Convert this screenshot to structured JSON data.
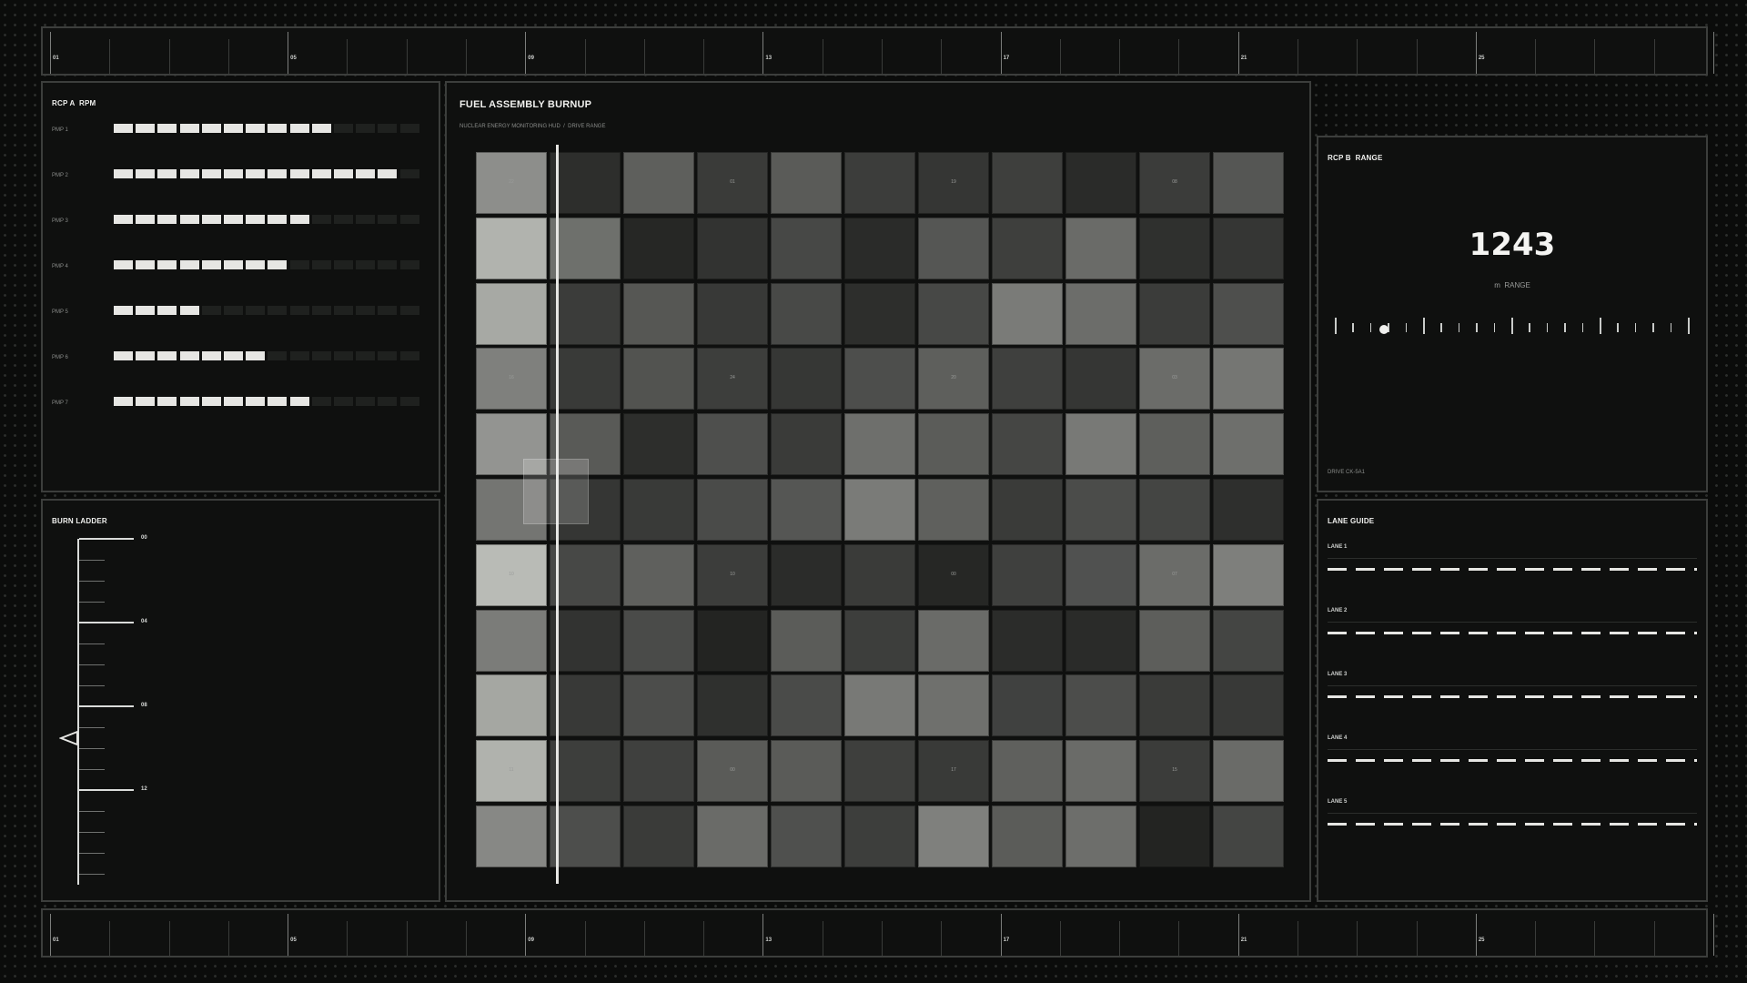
{
  "top_ruler": {
    "labels": [
      "01",
      "05",
      "09",
      "13",
      "17",
      "21",
      "25"
    ]
  },
  "bottom_ruler": {
    "labels": [
      "01",
      "05",
      "09",
      "13",
      "17",
      "21",
      "25"
    ]
  },
  "rpm_panel": {
    "title": "RCP A  RPM",
    "total_segments": 14,
    "pumps": [
      {
        "label": "PMP 1",
        "active": 10
      },
      {
        "label": "PMP 2",
        "active": 13
      },
      {
        "label": "PMP 3",
        "active": 9
      },
      {
        "label": "PMP 4",
        "active": 8
      },
      {
        "label": "PMP 5",
        "active": 4
      },
      {
        "label": "PMP 6",
        "active": 7
      },
      {
        "label": "PMP 7",
        "active": 9
      }
    ]
  },
  "burn_ladder": {
    "title": "BURN LADDER",
    "labels": [
      "00",
      "04",
      "08",
      "12"
    ],
    "marker_value": 9.5
  },
  "burnup": {
    "title": "FUEL ASSEMBLY BURNUP",
    "subtitle": "NUCLEAR ENERGY MONITORING HUD  /  DRIVE RANGE",
    "scan_column": 1.1,
    "grid": [
      [
        "#8d8e8b",
        "#2d2e2c",
        "#5e5f5c",
        "#3a3b39",
        "#5a5b58",
        "#3c3d3b",
        "#353634",
        "#3e3f3d",
        "#2a2b29",
        "#3b3c3a",
        "#555654"
      ],
      [
        "#b1b3ae",
        "#6e706c",
        "#262725",
        "#323331",
        "#474846",
        "#2a2b29",
        "#555654",
        "#3e3f3d",
        "#6a6b68",
        "#2f302e",
        "#353634"
      ],
      [
        "#a7a9a4",
        "#3b3c3a",
        "#565754",
        "#383937",
        "#484947",
        "#2d2e2c",
        "#474846",
        "#7a7b78",
        "#6c6d6a",
        "#3b3c3a",
        "#4e4f4d"
      ],
      [
        "#7f807d",
        "#393a38",
        "#525350",
        "#3d3e3c",
        "#363735",
        "#4d4e4c",
        "#5e5f5c",
        "#3f403e",
        "#353634",
        "#6b6c69",
        "#757673"
      ],
      [
        "#939491",
        "#595a57",
        "#2d2e2c",
        "#4e4f4d",
        "#3a3b39",
        "#6e6f6c",
        "#5b5c59",
        "#454644",
        "#787976",
        "#5e5f5c",
        "#6e6f6c"
      ],
      [
        "#747572",
        "#353634",
        "#393a38",
        "#4a4b49",
        "#555654",
        "#7a7b78",
        "#5f605d",
        "#3a3b39",
        "#4b4c4a",
        "#444543",
        "#2e2f2d"
      ],
      [
        "#b9bbb6",
        "#474846",
        "#5f605d",
        "#3c3d3b",
        "#2b2c2a",
        "#3a3b39",
        "#262725",
        "#3f403e",
        "#505150",
        "#6b6c69",
        "#7e7f7c"
      ],
      [
        "#7b7c79",
        "#323331",
        "#4a4b49",
        "#232422",
        "#5b5c59",
        "#3d3e3c",
        "#6a6b68",
        "#2b2c2a",
        "#2a2b29",
        "#5d5e5b",
        "#444543"
      ],
      [
        "#a5a7a2",
        "#383937",
        "#4c4d4b",
        "#2f302e",
        "#4a4b49",
        "#787976",
        "#6f706d",
        "#404140",
        "#4c4d4b",
        "#3a3b39",
        "#383937"
      ],
      [
        "#b0b2ad",
        "#3d3e3c",
        "#3f403e",
        "#5a5b58",
        "#5a5b58",
        "#3e3f3d",
        "#393a38",
        "#5f605d",
        "#6a6b68",
        "#3b3c3a",
        "#6a6b68"
      ],
      [
        "#878885",
        "#4d4e4c",
        "#3a3b39",
        "#6a6b68",
        "#4f504e",
        "#3d3e3c",
        "#7f807d",
        "#5b5c59",
        "#6d6e6b",
        "#232422",
        "#444543"
      ]
    ],
    "labels": [
      {
        "row": 0,
        "col": 0,
        "text": "22"
      },
      {
        "row": 0,
        "col": 3,
        "text": "01"
      },
      {
        "row": 0,
        "col": 6,
        "text": "19"
      },
      {
        "row": 0,
        "col": 9,
        "text": "08"
      },
      {
        "row": 3,
        "col": 0,
        "text": "16"
      },
      {
        "row": 3,
        "col": 3,
        "text": "24"
      },
      {
        "row": 3,
        "col": 6,
        "text": "20"
      },
      {
        "row": 3,
        "col": 9,
        "text": "03"
      },
      {
        "row": 6,
        "col": 0,
        "text": "10"
      },
      {
        "row": 6,
        "col": 3,
        "text": "10"
      },
      {
        "row": 6,
        "col": 6,
        "text": "00"
      },
      {
        "row": 6,
        "col": 9,
        "text": "07"
      },
      {
        "row": 9,
        "col": 0,
        "text": "11"
      },
      {
        "row": 9,
        "col": 3,
        "text": "00"
      },
      {
        "row": 9,
        "col": 6,
        "text": "17"
      },
      {
        "row": 9,
        "col": 9,
        "text": "15"
      }
    ]
  },
  "range_panel": {
    "title": "RCP B  RANGE",
    "value": "1243",
    "unit": "m  RANGE",
    "dial_position": 0.14,
    "footer": "DRIVE CK-5A1"
  },
  "lane_panel": {
    "title": "LANE GUIDE",
    "lanes": [
      "LANE 1",
      "LANE 2",
      "LANE 3",
      "LANE 4",
      "LANE 5"
    ]
  }
}
